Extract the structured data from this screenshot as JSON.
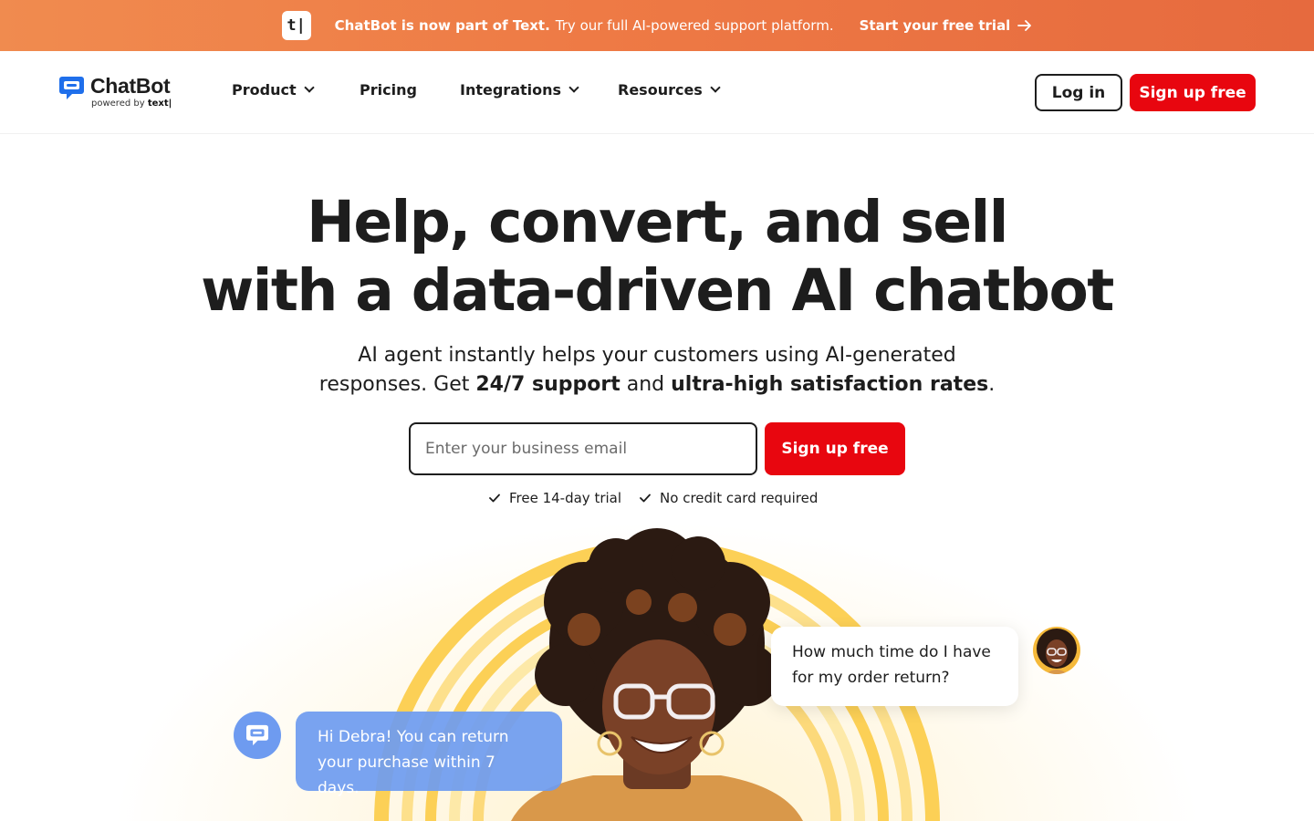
{
  "banner": {
    "badge": "t|",
    "message_bold": "ChatBot is now part of Text.",
    "message": "Try our full AI-powered support platform.",
    "cta": "Start your free trial"
  },
  "brand": {
    "name": "ChatBot",
    "powered_prefix": "powered by",
    "powered_brand": "text|",
    "accent": "#1f6feb",
    "cta_color": "#e8060f",
    "banner_color": "#ee7a45"
  },
  "nav": {
    "items": [
      {
        "label": "Product",
        "has_dropdown": true
      },
      {
        "label": "Pricing",
        "has_dropdown": false
      },
      {
        "label": "Integrations",
        "has_dropdown": true
      },
      {
        "label": "Resources",
        "has_dropdown": true
      }
    ],
    "login": "Log in",
    "signup": "Sign up free"
  },
  "hero": {
    "title_line1": "Help, convert, and sell",
    "title_line2": "with a data-driven AI chatbot",
    "sub_line1": "AI agent instantly helps your customers using AI-generated",
    "sub_line2_prefix": "responses. Get",
    "sub_bold1": "24/7 support",
    "sub_mid": "and",
    "sub_bold2": "ultra-high satisfaction rates",
    "sub_end": ".",
    "email_placeholder": "Enter your business email",
    "signup": "Sign up free",
    "perks": [
      "Free 14-day trial",
      "No credit card required"
    ]
  },
  "chat": {
    "bot_message": "Hi Debra! You can return your purchase within 7 days.",
    "user_message": "How much time do I have for my order return?"
  }
}
